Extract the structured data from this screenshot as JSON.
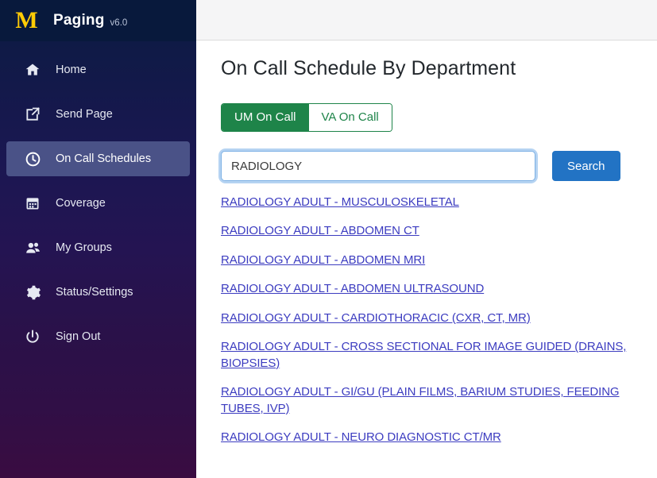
{
  "brand": {
    "logo_letter": "M",
    "title": "Paging",
    "version": "v6.0"
  },
  "sidebar": {
    "items": [
      {
        "label": "Home",
        "icon": "home-icon",
        "active": false
      },
      {
        "label": "Send Page",
        "icon": "send-page-icon",
        "active": false
      },
      {
        "label": "On Call Schedules",
        "icon": "clock-icon",
        "active": true
      },
      {
        "label": "Coverage",
        "icon": "calendar-icon",
        "active": false
      },
      {
        "label": "My Groups",
        "icon": "users-icon",
        "active": false
      },
      {
        "label": "Status/Settings",
        "icon": "gear-icon",
        "active": false
      },
      {
        "label": "Sign Out",
        "icon": "power-icon",
        "active": false
      }
    ]
  },
  "main": {
    "page_title": "On Call Schedule By Department",
    "tabs": [
      {
        "label": "UM On Call",
        "active": true
      },
      {
        "label": "VA On Call",
        "active": false
      }
    ],
    "search": {
      "value": "RADIOLOGY",
      "placeholder": "",
      "button_label": "Search"
    },
    "results": [
      "RADIOLOGY ADULT - MUSCULOSKELETAL",
      "RADIOLOGY ADULT - ABDOMEN CT",
      "RADIOLOGY ADULT - ABDOMEN MRI",
      "RADIOLOGY ADULT - ABDOMEN ULTRASOUND",
      "RADIOLOGY ADULT - CARDIOTHORACIC (CXR, CT, MR)",
      "RADIOLOGY ADULT - CROSS SECTIONAL FOR IMAGE GUIDED (DRAINS, BIOPSIES)",
      "RADIOLOGY ADULT - GI/GU (PLAIN FILMS, BARIUM STUDIES, FEEDING TUBES, IVP)",
      "RADIOLOGY ADULT - NEURO DIAGNOSTIC CT/MR"
    ]
  },
  "colors": {
    "brand_navy": "#08193c",
    "brand_maize": "#ffcb05",
    "sidebar_active": "#4a5287",
    "tab_green": "#1e8449",
    "button_blue": "#2273c4",
    "link_blue": "#3c3cc0"
  }
}
